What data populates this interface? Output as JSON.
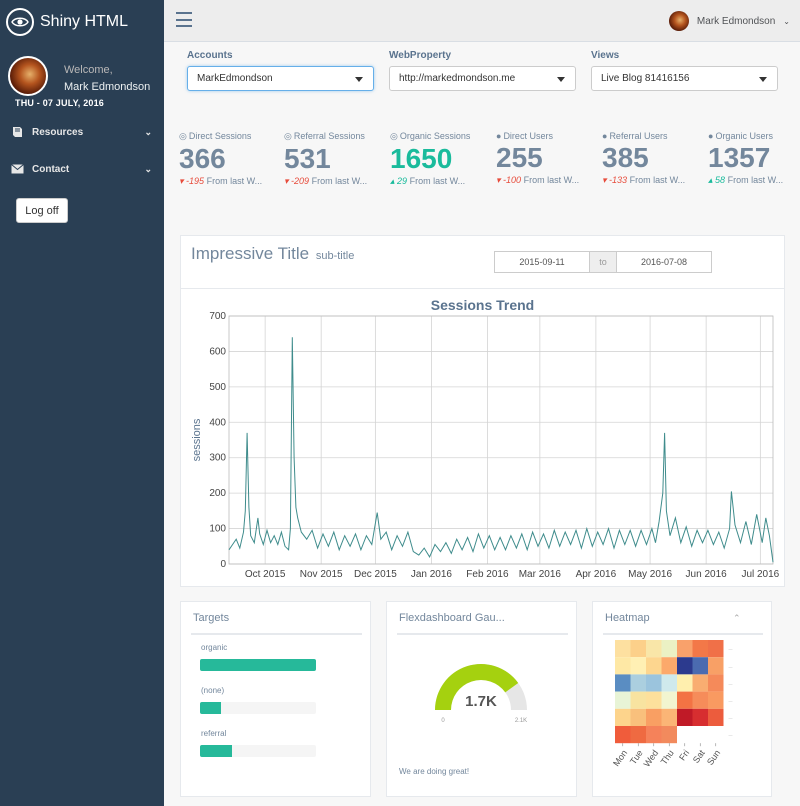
{
  "app": {
    "title": "Shiny HTML"
  },
  "sidebar": {
    "welcome": "Welcome,",
    "username": "Mark Edmondson",
    "date": "THU - 07 JULY, 2016",
    "items": [
      {
        "label": "Resources",
        "icon": "book-icon"
      },
      {
        "label": "Contact",
        "icon": "envelope-icon"
      }
    ],
    "logoff_label": "Log off"
  },
  "topnav": {
    "user_name": "Mark Edmondson"
  },
  "selectors": {
    "accounts": {
      "label": "Accounts",
      "value": "MarkEdmondson"
    },
    "webproperty": {
      "label": "WebProperty",
      "value": "http://markedmondson.me"
    },
    "views": {
      "label": "Views",
      "value": "Live Blog 81416156"
    }
  },
  "stats": [
    {
      "label": "Direct Sessions",
      "icon": "eye-icon",
      "value": "366",
      "delta": "-195",
      "trend": "down",
      "suffix": "From last W..."
    },
    {
      "label": "Referral Sessions",
      "icon": "eye-icon",
      "value": "531",
      "delta": "-209",
      "trend": "down",
      "suffix": "From last W..."
    },
    {
      "label": "Organic Sessions",
      "icon": "eye-icon",
      "value": "1650",
      "delta": "29",
      "trend": "up",
      "suffix": "From last W...",
      "highlight": true
    },
    {
      "label": "Direct Users",
      "icon": "user-icon",
      "value": "255",
      "delta": "-100",
      "trend": "down",
      "suffix": "From last W..."
    },
    {
      "label": "Referral Users",
      "icon": "user-icon",
      "value": "385",
      "delta": "-133",
      "trend": "down",
      "suffix": "From last W..."
    },
    {
      "label": "Organic Users",
      "icon": "user-icon",
      "value": "1357",
      "delta": "58",
      "trend": "up",
      "suffix": "From last W..."
    }
  ],
  "panel": {
    "title": "Impressive Title",
    "subtitle": "sub-title",
    "date_from": "2015-09-11",
    "date_to": "2016-07-08",
    "date_sep": "to"
  },
  "chart_data": {
    "type": "line",
    "title": "Sessions Trend",
    "xlabel": "",
    "ylabel": "sessions",
    "ylim": [
      0,
      700
    ],
    "yticks": [
      0,
      100,
      200,
      300,
      400,
      500,
      600,
      700
    ],
    "xlim": [
      "2015-09-11",
      "2016-07-08"
    ],
    "xticks": [
      {
        "date": "2015-10-01",
        "label": "Oct 2015"
      },
      {
        "date": "2015-11-01",
        "label": "Nov 2015"
      },
      {
        "date": "2015-12-01",
        "label": "Dec 2015"
      },
      {
        "date": "2016-01-01",
        "label": "Jan 2016"
      },
      {
        "date": "2016-02-01",
        "label": "Feb 2016"
      },
      {
        "date": "2016-03-01",
        "label": "Mar 2016"
      },
      {
        "date": "2016-04-01",
        "label": "Apr 2016"
      },
      {
        "date": "2016-05-01",
        "label": "May 2016"
      },
      {
        "date": "2016-06-01",
        "label": "Jun 2016"
      },
      {
        "date": "2016-07-01",
        "label": "Jul 2016"
      }
    ],
    "grid": true,
    "color": "#3f8c8c",
    "series": [
      {
        "points": [
          [
            "2015-09-11",
            40
          ],
          [
            "2015-09-13",
            55
          ],
          [
            "2015-09-15",
            70
          ],
          [
            "2015-09-17",
            45
          ],
          [
            "2015-09-19",
            90
          ],
          [
            "2015-09-20",
            150
          ],
          [
            "2015-09-21",
            370
          ],
          [
            "2015-09-22",
            160
          ],
          [
            "2015-09-23",
            80
          ],
          [
            "2015-09-25",
            60
          ],
          [
            "2015-09-27",
            130
          ],
          [
            "2015-09-28",
            85
          ],
          [
            "2015-09-30",
            55
          ],
          [
            "2015-10-02",
            95
          ],
          [
            "2015-10-04",
            60
          ],
          [
            "2015-10-06",
            80
          ],
          [
            "2015-10-08",
            55
          ],
          [
            "2015-10-10",
            90
          ],
          [
            "2015-10-12",
            50
          ],
          [
            "2015-10-14",
            40
          ],
          [
            "2015-10-15",
            100
          ],
          [
            "2015-10-16",
            640
          ],
          [
            "2015-10-17",
            300
          ],
          [
            "2015-10-18",
            160
          ],
          [
            "2015-10-19",
            130
          ],
          [
            "2015-10-21",
            90
          ],
          [
            "2015-10-24",
            70
          ],
          [
            "2015-10-27",
            95
          ],
          [
            "2015-10-30",
            45
          ],
          [
            "2015-11-02",
            85
          ],
          [
            "2015-11-05",
            50
          ],
          [
            "2015-11-08",
            90
          ],
          [
            "2015-11-11",
            40
          ],
          [
            "2015-11-14",
            80
          ],
          [
            "2015-11-17",
            50
          ],
          [
            "2015-11-20",
            85
          ],
          [
            "2015-11-23",
            40
          ],
          [
            "2015-11-26",
            80
          ],
          [
            "2015-11-29",
            55
          ],
          [
            "2015-12-02",
            145
          ],
          [
            "2015-12-04",
            70
          ],
          [
            "2015-12-07",
            90
          ],
          [
            "2015-12-10",
            40
          ],
          [
            "2015-12-13",
            80
          ],
          [
            "2015-12-16",
            50
          ],
          [
            "2015-12-19",
            90
          ],
          [
            "2015-12-22",
            35
          ],
          [
            "2015-12-25",
            25
          ],
          [
            "2015-12-28",
            45
          ],
          [
            "2015-12-31",
            20
          ],
          [
            "2016-01-03",
            55
          ],
          [
            "2016-01-06",
            35
          ],
          [
            "2016-01-09",
            60
          ],
          [
            "2016-01-12",
            30
          ],
          [
            "2016-01-15",
            70
          ],
          [
            "2016-01-18",
            40
          ],
          [
            "2016-01-21",
            75
          ],
          [
            "2016-01-24",
            35
          ],
          [
            "2016-01-27",
            85
          ],
          [
            "2016-01-30",
            45
          ],
          [
            "2016-02-02",
            80
          ],
          [
            "2016-02-05",
            40
          ],
          [
            "2016-02-08",
            75
          ],
          [
            "2016-02-11",
            40
          ],
          [
            "2016-02-14",
            80
          ],
          [
            "2016-02-17",
            45
          ],
          [
            "2016-02-20",
            85
          ],
          [
            "2016-02-23",
            40
          ],
          [
            "2016-02-26",
            90
          ],
          [
            "2016-02-29",
            50
          ],
          [
            "2016-03-03",
            85
          ],
          [
            "2016-03-06",
            45
          ],
          [
            "2016-03-09",
            95
          ],
          [
            "2016-03-12",
            50
          ],
          [
            "2016-03-15",
            90
          ],
          [
            "2016-03-18",
            55
          ],
          [
            "2016-03-21",
            95
          ],
          [
            "2016-03-24",
            45
          ],
          [
            "2016-03-27",
            100
          ],
          [
            "2016-03-30",
            50
          ],
          [
            "2016-04-02",
            90
          ],
          [
            "2016-04-05",
            55
          ],
          [
            "2016-04-08",
            100
          ],
          [
            "2016-04-11",
            45
          ],
          [
            "2016-04-14",
            95
          ],
          [
            "2016-04-17",
            55
          ],
          [
            "2016-04-20",
            95
          ],
          [
            "2016-04-23",
            50
          ],
          [
            "2016-04-26",
            95
          ],
          [
            "2016-04-29",
            55
          ],
          [
            "2016-05-02",
            100
          ],
          [
            "2016-05-04",
            60
          ],
          [
            "2016-05-06",
            120
          ],
          [
            "2016-05-08",
            200
          ],
          [
            "2016-05-09",
            370
          ],
          [
            "2016-05-10",
            150
          ],
          [
            "2016-05-12",
            80
          ],
          [
            "2016-05-15",
            130
          ],
          [
            "2016-05-18",
            60
          ],
          [
            "2016-05-21",
            105
          ],
          [
            "2016-05-24",
            50
          ],
          [
            "2016-05-27",
            95
          ],
          [
            "2016-05-30",
            60
          ],
          [
            "2016-06-02",
            95
          ],
          [
            "2016-06-05",
            55
          ],
          [
            "2016-06-08",
            90
          ],
          [
            "2016-06-11",
            45
          ],
          [
            "2016-06-14",
            100
          ],
          [
            "2016-06-15",
            205
          ],
          [
            "2016-06-17",
            110
          ],
          [
            "2016-06-20",
            60
          ],
          [
            "2016-06-23",
            120
          ],
          [
            "2016-06-26",
            55
          ],
          [
            "2016-06-29",
            140
          ],
          [
            "2016-07-02",
            60
          ],
          [
            "2016-07-04",
            130
          ],
          [
            "2016-07-06",
            80
          ],
          [
            "2016-07-08",
            5
          ]
        ]
      }
    ]
  },
  "targets": {
    "title": "Targets",
    "items": [
      {
        "label": "organic",
        "value": 1.0
      },
      {
        "label": "(none)",
        "value": 0.18
      },
      {
        "label": "referral",
        "value": 0.28
      }
    ]
  },
  "gauge": {
    "title": "Flexdashboard Gau...",
    "value_label": "1.7K",
    "min_label": "0",
    "max_label": "2.1K",
    "fraction": 0.8,
    "color": "#a5d10f",
    "note": "We are doing great!"
  },
  "heatmap": {
    "title": "Heatmap",
    "xlabels": [
      "Mon",
      "Tue",
      "Wed",
      "Thu",
      "Fri",
      "Sat",
      "Sun"
    ],
    "ylabels": [
      "",
      "",
      "",
      "",
      "",
      ""
    ],
    "rows": [
      [
        "#fde0a0",
        "#fcd08a",
        "#f9e6a8",
        "#ebf1c4",
        "#f9a16b",
        "#f37848",
        "#f07048"
      ],
      [
        "#fee8a5",
        "#fff0b4",
        "#fdd68f",
        "#fca96b",
        "#2c3a8e",
        "#4b6bb0",
        "#f8a066"
      ],
      [
        "#5a8dc2",
        "#abcfdf",
        "#9bc4dd",
        "#cfe9ec",
        "#ffefae",
        "#f9ad71",
        "#f58a5a"
      ],
      [
        "#e8f4d6",
        "#f8e3a0",
        "#fde09c",
        "#f2f5d0",
        "#f37344",
        "#f68c5a",
        "#f99a61"
      ],
      [
        "#fdd48c",
        "#f9c07c",
        "#f99f63",
        "#fbb576",
        "#c01a27",
        "#d72e30",
        "#ec5c3d"
      ],
      [
        "#f05c3b",
        "#ef6a41",
        "#f5825a",
        "#f28a5d",
        null,
        null,
        null
      ]
    ]
  }
}
